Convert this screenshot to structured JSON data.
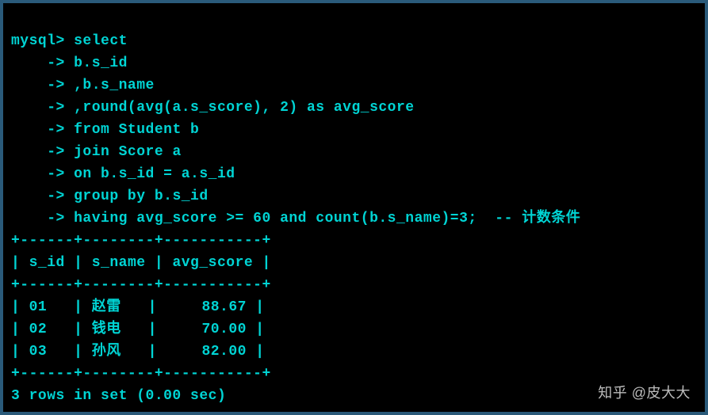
{
  "prompt": "mysql>",
  "continuation": "    ->",
  "query_lines": [
    "select",
    "b.s_id",
    ",b.s_name",
    ",round(avg(a.s_score), 2) as avg_score",
    "from Student b",
    "join Score a",
    "on b.s_id = a.s_id",
    "group by b.s_id",
    "having avg_score >= 60 and count(b.s_name)=3;  -- 计数条件"
  ],
  "table": {
    "border": "+------+--------+-----------+",
    "headers": [
      "s_id",
      "s_name",
      "avg_score"
    ],
    "rows": [
      {
        "s_id": "01",
        "s_name": "赵雷",
        "avg_score": "88.67"
      },
      {
        "s_id": "02",
        "s_name": "钱电",
        "avg_score": "70.00"
      },
      {
        "s_id": "03",
        "s_name": "孙风",
        "avg_score": "82.00"
      }
    ]
  },
  "footer": "3 rows in set (0.00 sec)",
  "watermark": "知乎 @皮大大"
}
